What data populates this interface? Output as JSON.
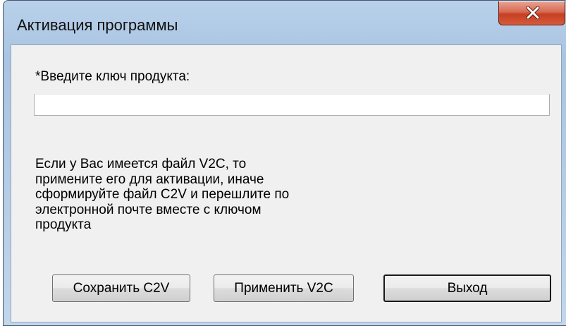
{
  "window": {
    "title": "Активация программы"
  },
  "form": {
    "key_label": "*Введите ключ продукта:",
    "key_value": "",
    "info_lines": [
      "Если у Вас имеется файл V2C, то",
      "примените его для активации, иначе",
      "сформируйте файл C2V и перешлите по",
      "электронной почте вместе с ключом",
      "продукта"
    ]
  },
  "buttons": {
    "save_label": "Сохранить C2V",
    "apply_label": "Применить V2C",
    "exit_label": "Выход"
  },
  "icons": {
    "close": "close-icon"
  },
  "colors": {
    "titlebar": "#b9d1ea",
    "close_button": "#c73f22",
    "client_background": "#f0f0f0"
  }
}
